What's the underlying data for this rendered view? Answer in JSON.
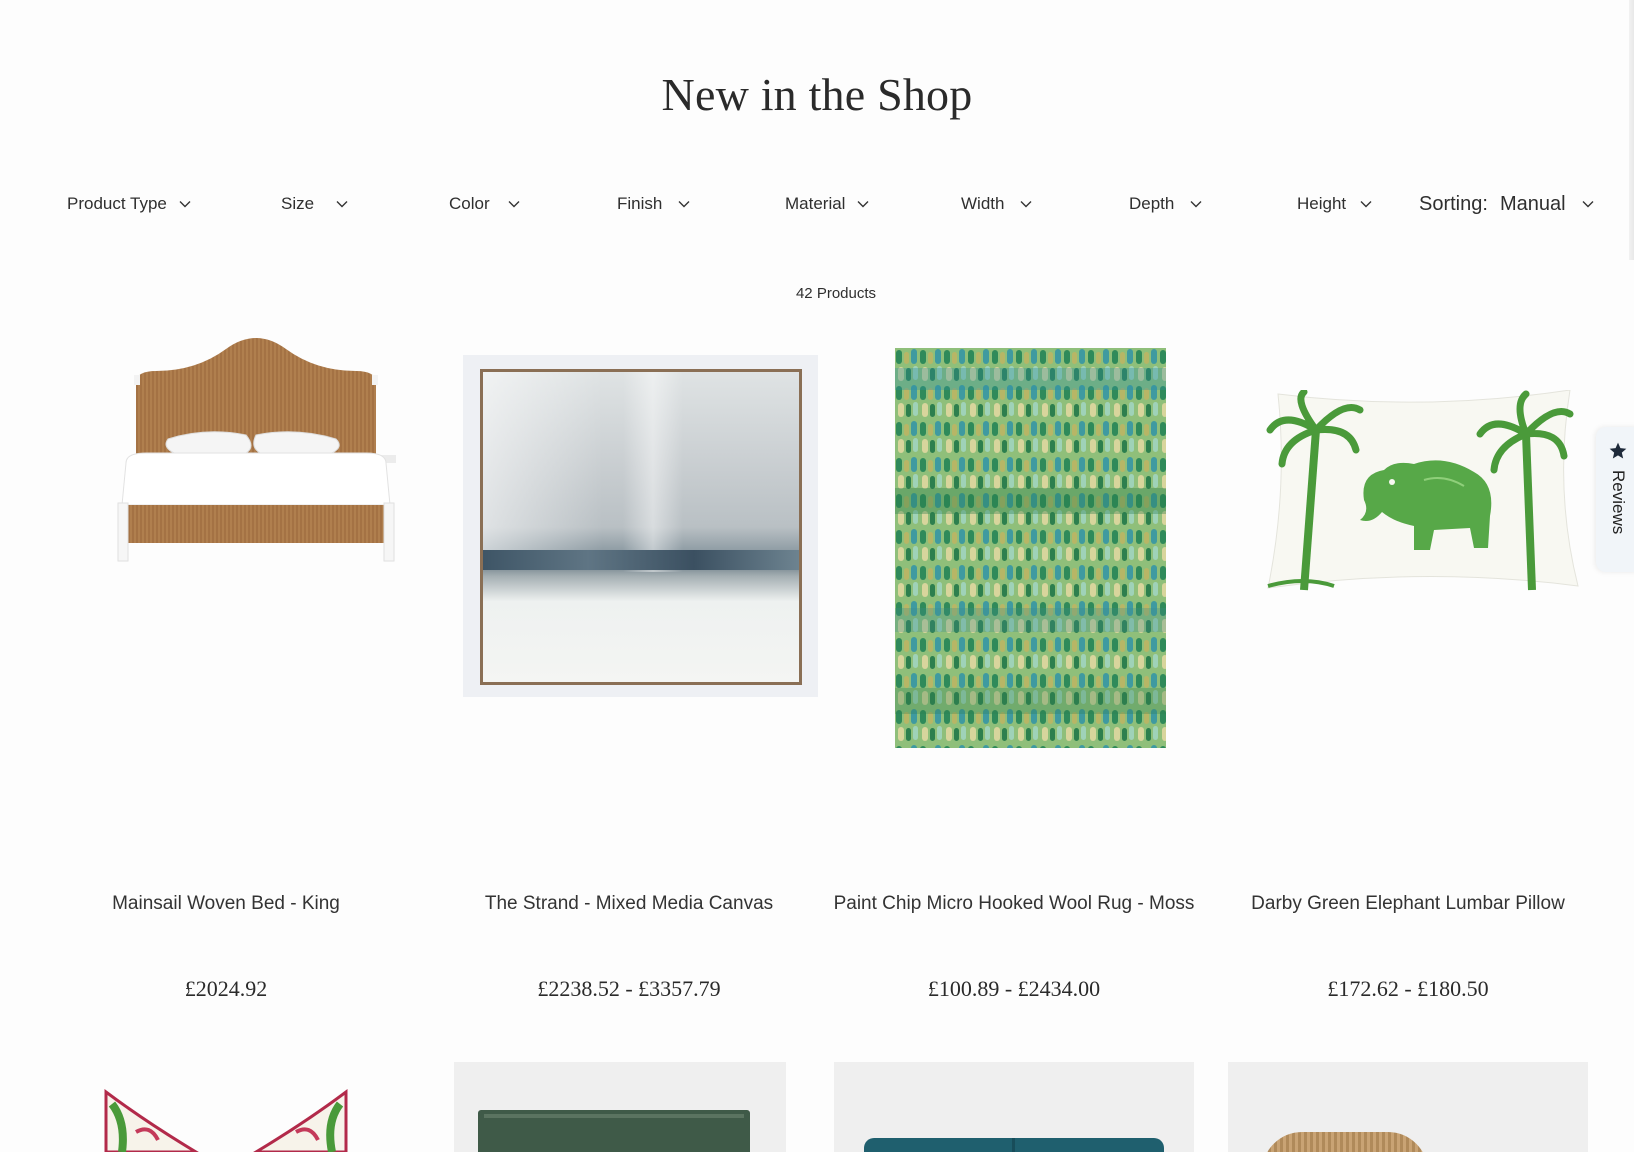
{
  "page_title": "New in the Shop",
  "filters": [
    {
      "label": "Product Type"
    },
    {
      "label": "Size"
    },
    {
      "label": "Color"
    },
    {
      "label": "Finish"
    },
    {
      "label": "Material"
    },
    {
      "label": "Width"
    },
    {
      "label": "Depth"
    },
    {
      "label": "Height"
    }
  ],
  "sorting": {
    "label": "Sorting:",
    "value": "Manual"
  },
  "product_count": "42 Products",
  "products": [
    {
      "name": "Mainsail Woven Bed - King",
      "price": "£2024.92"
    },
    {
      "name": "The Strand - Mixed Media Canvas",
      "price": "£2238.52 - £3357.79"
    },
    {
      "name": "Paint Chip Micro Hooked Wool Rug - Moss",
      "price": "£100.89 - £2434.00"
    },
    {
      "name": "Darby Green Elephant Lumbar Pillow",
      "price": "£172.62 - £180.50"
    }
  ],
  "reviews_tab": {
    "label": "Reviews",
    "icon": "star-icon"
  }
}
